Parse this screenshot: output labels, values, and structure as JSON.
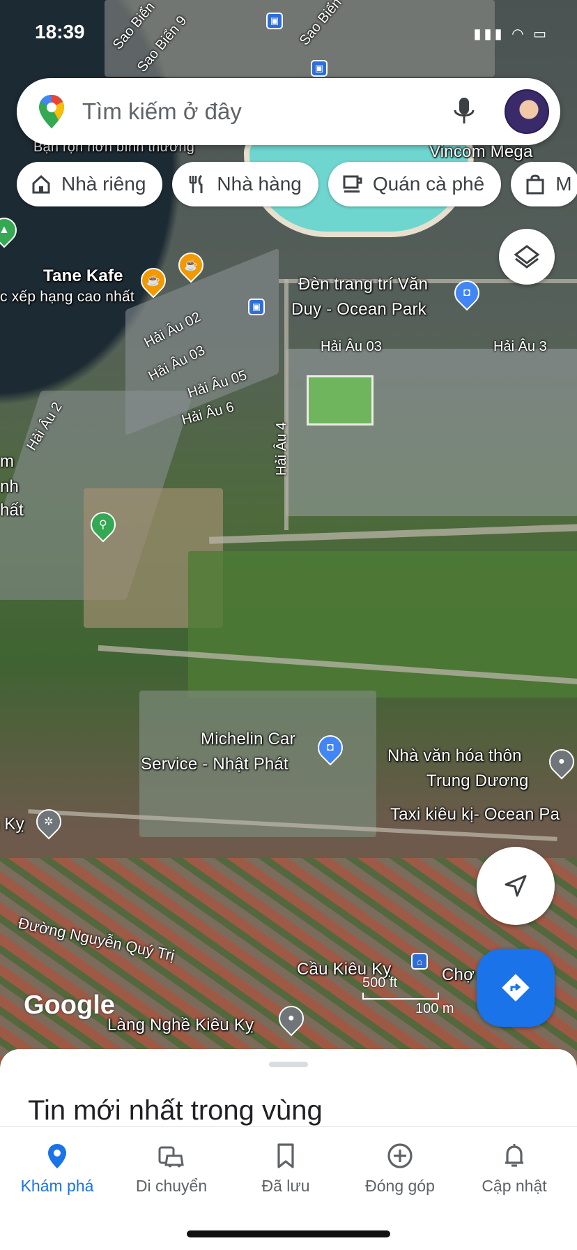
{
  "status_bar": {
    "time": "18:39",
    "icons": "▮▮▮ ◠ ▭"
  },
  "search": {
    "placeholder": "Tìm kiếm ở đây"
  },
  "chips": [
    {
      "label": "Nhà riêng",
      "icon": "home-icon"
    },
    {
      "label": "Nhà hàng",
      "icon": "restaurant-icon"
    },
    {
      "label": "Quán cà phê",
      "icon": "cafe-icon"
    },
    {
      "label": "M",
      "icon": "shopping-bag-icon"
    }
  ],
  "map": {
    "labels": {
      "busy": "Bận rộn hơn bình thường",
      "vincom": "Vincom Mega",
      "tane": "Tane Kafe",
      "tane_sub": "c xếp hạng cao nhất",
      "den_trang_tri": "Đèn trang trí Văn",
      "den_trang_tri_2": "Duy - Ocean Park",
      "michelin": "Michelin Car",
      "michelin_2": "Service - Nhật Phát",
      "nha_van_hoa": "Nhà văn hóa thôn",
      "nha_van_hoa_2": "Trung Dương",
      "taxi": "Taxi kiêu kị- Ocean Pa",
      "cau_kieu_ky": "Cầu Kiêu Kỵ",
      "cho": "Chợ",
      "lang_nghe": "Làng Nghề Kiêu Kỵ",
      "ky": "n Kỵ",
      "m_left": "m",
      "nh_left": "nh",
      "hat_left": "hất"
    },
    "streets": {
      "sao_bien_1": "Sao Biển",
      "sao_bien_2": "Sao Biển 9",
      "sao_bien_3": "Sao Biển",
      "hai_au_02": "Hải Âu 02",
      "hai_au_03": "Hải Âu 03",
      "hai_au_05": "Hải Âu 05",
      "hai_au_6": "Hải Âu 6",
      "hai_au_2": "Hải Âu 2",
      "hai_au_4": "Hải Âu 4",
      "hai_au_03_b": "Hải Âu 03",
      "hai_au_3": "Hải Âu 3",
      "nguyen_quy_tri": "Đường Nguyễn Quý Trị"
    },
    "google_mark": "Google",
    "scale_ft": "500 ft",
    "scale_m": "100 m"
  },
  "sheet": {
    "title": "Tin mới nhất trong vùng"
  },
  "nav": [
    {
      "label": "Khám phá",
      "icon": "explore-pin-icon",
      "active": true
    },
    {
      "label": "Di chuyển",
      "icon": "commute-car-icon",
      "active": false
    },
    {
      "label": "Đã lưu",
      "icon": "bookmark-icon",
      "active": false
    },
    {
      "label": "Đóng góp",
      "icon": "add-circle-icon",
      "active": false
    },
    {
      "label": "Cập nhật",
      "icon": "bell-icon",
      "active": false
    }
  ],
  "colors": {
    "accent": "#1a73e8",
    "pin_orange": "#f29900",
    "pin_blue": "#4285f4",
    "pin_green": "#34a853",
    "pin_gray": "#70757a"
  }
}
